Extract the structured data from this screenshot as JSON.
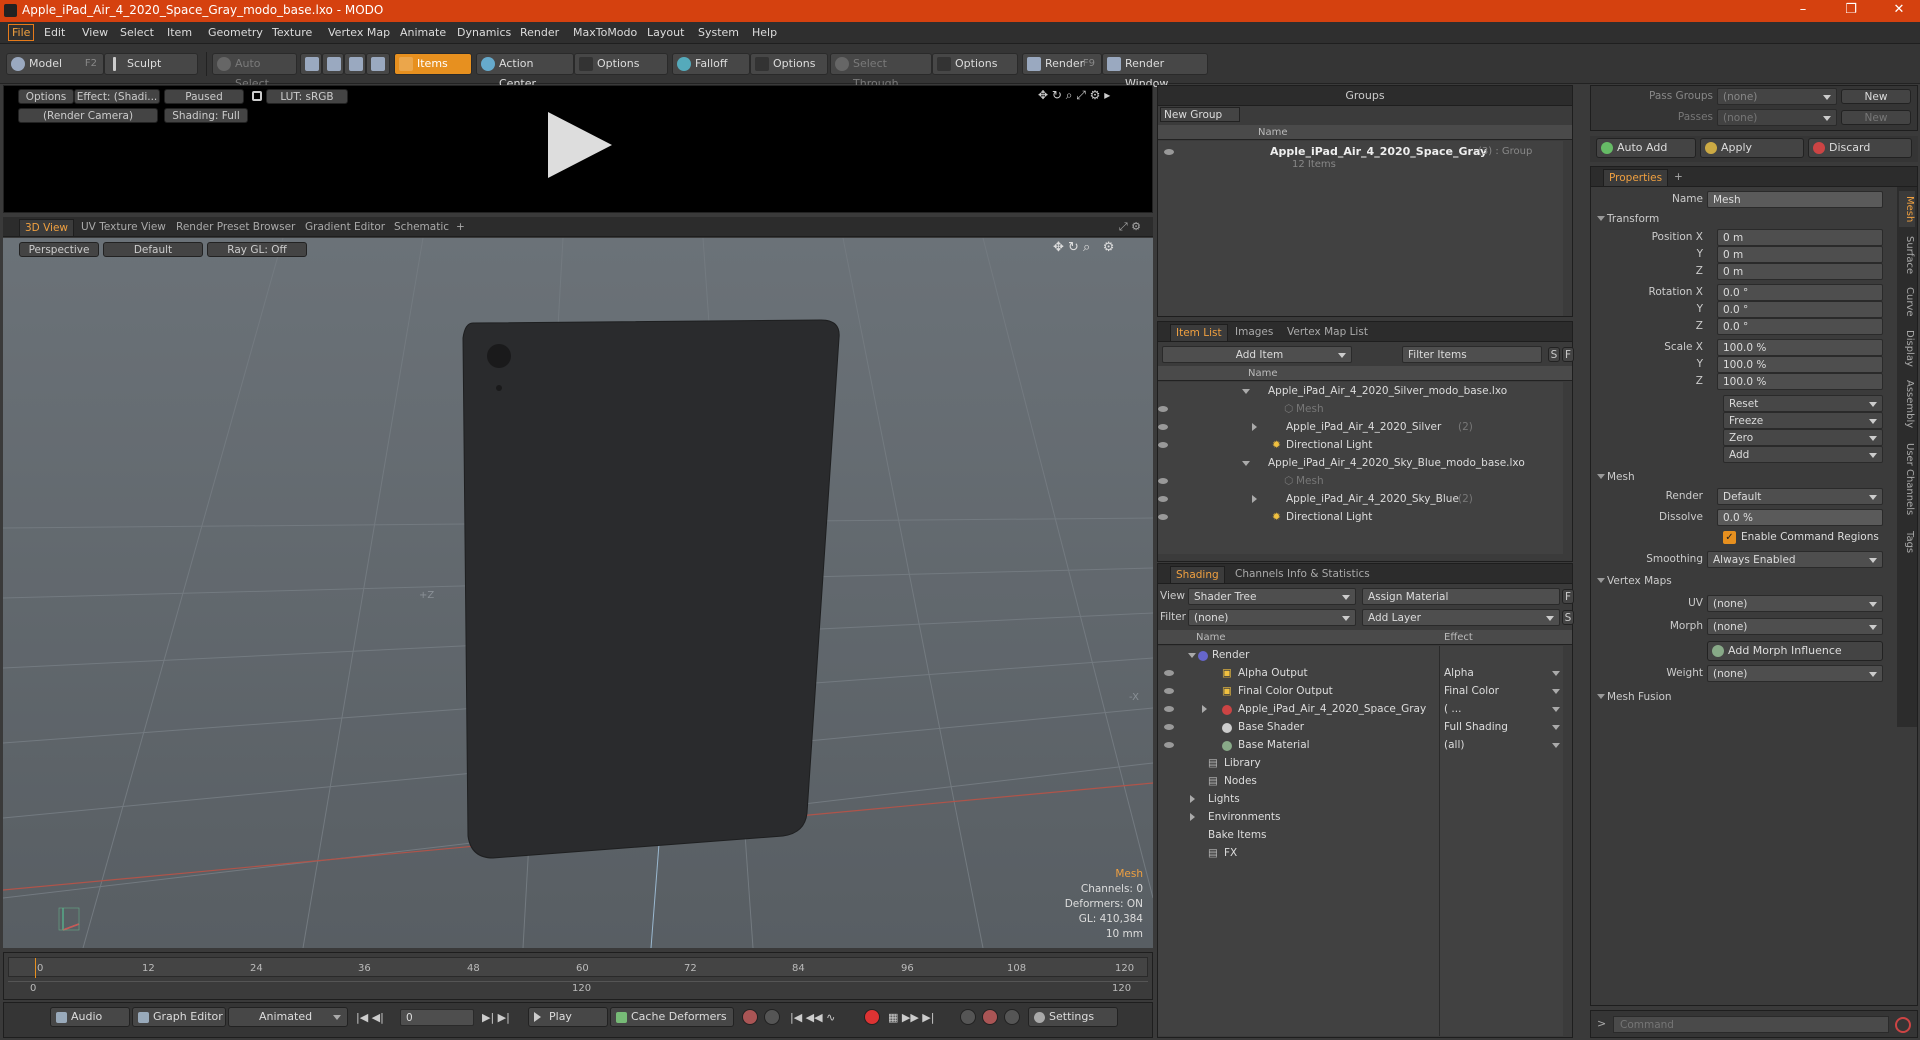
{
  "title": "Apple_iPad_Air_4_2020_Space_Gray_modo_base.lxo - MODO",
  "menus": [
    "File",
    "Edit",
    "View",
    "Select",
    "Item",
    "Geometry",
    "Texture",
    "Vertex Map",
    "Animate",
    "Dynamics",
    "Render",
    "MaxToModo",
    "Layout",
    "System",
    "Help"
  ],
  "toolbar": {
    "model": "Model",
    "model_key": "F2",
    "sculpt": "Sculpt",
    "auto_select": "Auto Select",
    "items": "Items",
    "action_center": "Action Center",
    "options1": "Options",
    "falloff": "Falloff",
    "options2": "Options",
    "select_through": "Select Through",
    "options3": "Options",
    "render": "Render",
    "render_key": "F9",
    "render_window": "Render Window"
  },
  "preview": {
    "options": "Options",
    "effect": "Effect: (Shadi...",
    "paused": "Paused",
    "lut": "LUT: sRGB",
    "camera": "(Render Camera)",
    "shading": "Shading: Full"
  },
  "viewtabs": [
    "3D View",
    "UV Texture View",
    "Render Preset Browser",
    "Gradient Editor",
    "Schematic"
  ],
  "viewport": {
    "perspective": "Perspective",
    "default": "Default",
    "raygl": "Ray GL: Off",
    "axis_z": "+Z",
    "axis_x": "-X"
  },
  "stats": {
    "type": "Mesh",
    "channels": "Channels: 0",
    "deformers": "Deformers: ON",
    "gl": "GL: 410,384",
    "unit": "10 mm"
  },
  "timeline": {
    "ticks": [
      "0",
      "12",
      "24",
      "36",
      "48",
      "60",
      "72",
      "84",
      "96",
      "108",
      "120"
    ],
    "sub": [
      "0",
      "120",
      "120"
    ]
  },
  "bottombar": {
    "audio": "Audio",
    "graph_editor": "Graph Editor",
    "animated": "Animated",
    "frame": "0",
    "play": "Play",
    "cache": "Cache Deformers",
    "settings": "Settings"
  },
  "groups": {
    "title": "Groups",
    "new_group": "New Group",
    "col_name": "Name",
    "item": "Apple_iPad_Air_4_2020_Space_Gray",
    "item_meta": "(3) : Group",
    "item_count": "12 Items"
  },
  "itemlist": {
    "tabs": [
      "Item List",
      "Images",
      "Vertex Map List"
    ],
    "add_item": "Add Item",
    "filter": "Filter Items",
    "col_name": "Name",
    "s": "S",
    "f": "F",
    "rows": [
      "Apple_iPad_Air_4_2020_Silver_modo_base.lxo",
      "Mesh",
      "Apple_iPad_Air_4_2020_Silver",
      "(2)",
      "Directional Light",
      "Apple_iPad_Air_4_2020_Sky_Blue_modo_base.lxo",
      "Mesh",
      "Apple_iPad_Air_4_2020_Sky_Blue",
      "(2)",
      "Directional Light"
    ]
  },
  "shading": {
    "tabs": [
      "Shading",
      "Channels",
      "Info & Statistics"
    ],
    "view_label": "View",
    "view": "Shader Tree",
    "assign": "Assign Material",
    "filter_label": "Filter",
    "filter": "(none)",
    "add_layer": "Add Layer",
    "f": "F",
    "s": "S",
    "col_name": "Name",
    "col_effect": "Effect",
    "rows": [
      [
        "Render",
        ""
      ],
      [
        "Alpha Output",
        "Alpha"
      ],
      [
        "Final Color Output",
        "Final Color"
      ],
      [
        "Apple_iPad_Air_4_2020_Space_Gray",
        "( ..."
      ],
      [
        "Base Shader",
        "Full Shading"
      ],
      [
        "Base Material",
        "(all)"
      ],
      [
        "Library",
        ""
      ],
      [
        "Nodes",
        ""
      ],
      [
        "Lights",
        ""
      ],
      [
        "Environments",
        ""
      ],
      [
        "Bake Items",
        ""
      ],
      [
        "FX",
        ""
      ]
    ]
  },
  "passes": {
    "pass_groups": "Pass Groups",
    "passes": "Passes",
    "none": "(none)",
    "new": "New"
  },
  "actions": {
    "auto_add": "Auto Add",
    "apply": "Apply",
    "discard": "Discard"
  },
  "properties": {
    "tab": "Properties",
    "name_label": "Name",
    "name": "Mesh",
    "transform": "Transform",
    "pos_label": "Position X",
    "rot_label": "Rotation X",
    "scale_label": "Scale X",
    "y": "Y",
    "z": "Z",
    "pos": [
      "0 m",
      "0 m",
      "0 m"
    ],
    "rot": [
      "0.0 °",
      "0.0 °",
      "0.0 °"
    ],
    "scale": [
      "100.0 %",
      "100.0 %",
      "100.0 %"
    ],
    "reset": "Reset",
    "freeze": "Freeze",
    "zero": "Zero",
    "add": "Add",
    "mesh": "Mesh",
    "render_label": "Render",
    "render": "Default",
    "dissolve_label": "Dissolve",
    "dissolve": "0.0 %",
    "enable_cmd": "Enable Command Regions",
    "smoothing_label": "Smoothing",
    "smoothing": "Always Enabled",
    "vertex_maps": "Vertex Maps",
    "uv_label": "UV",
    "uv": "(none)",
    "morph_label": "Morph",
    "morph": "(none)",
    "add_morph": "Add Morph Influence",
    "weight_label": "Weight",
    "weight": "(none)",
    "mesh_fusion": "Mesh Fusion"
  },
  "vtabs": [
    "Mesh",
    "Surface",
    "Curve",
    "Display",
    "Assembly",
    "User Channels",
    "Tags"
  ],
  "command": {
    "placeholder": "Command"
  }
}
